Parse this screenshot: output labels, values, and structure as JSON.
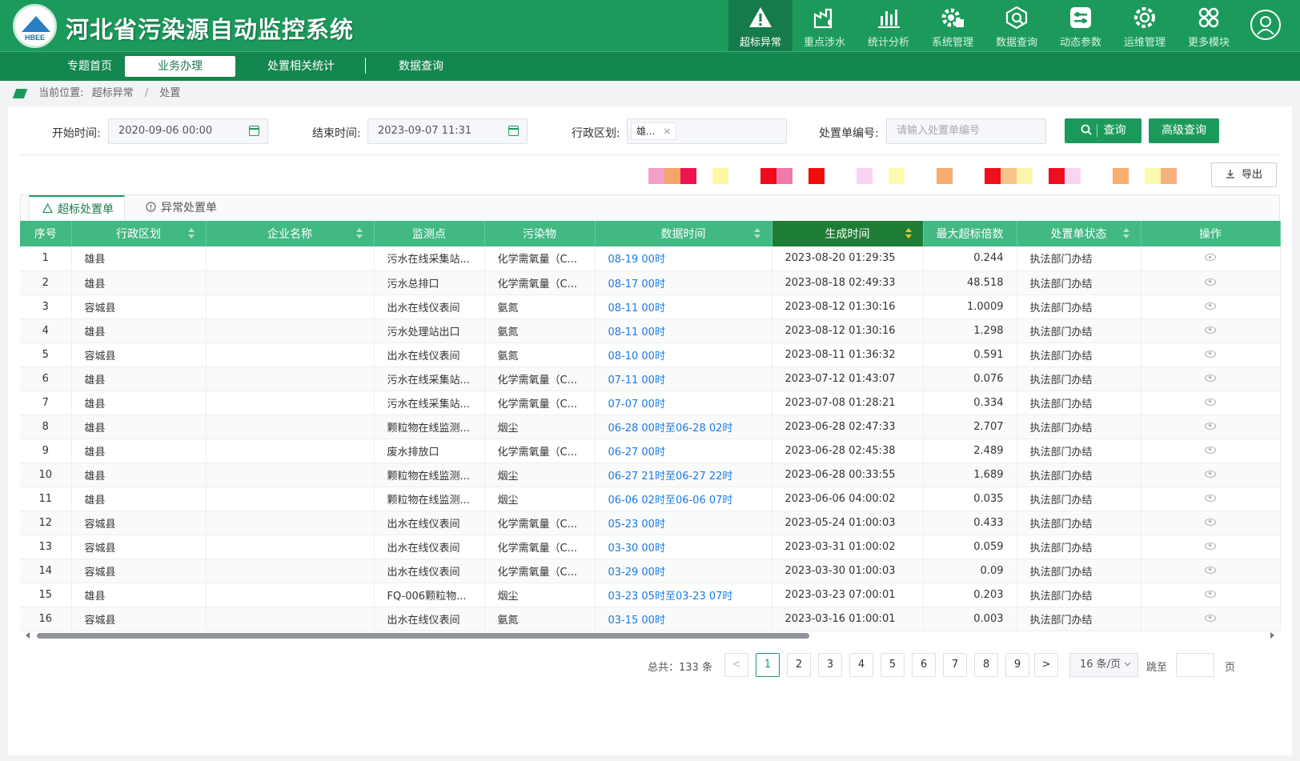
{
  "app": {
    "title": "河北省污染源自动监控系统",
    "logo_text": "HBEE"
  },
  "modules": [
    {
      "label": "超标异常",
      "icon": "warning-icon",
      "active": true
    },
    {
      "label": "重点涉水",
      "icon": "factory-icon"
    },
    {
      "label": "统计分析",
      "icon": "bar-chart-icon"
    },
    {
      "label": "系统管理",
      "icon": "gear-icon"
    },
    {
      "label": "数据查询",
      "icon": "data-search-icon"
    },
    {
      "label": "动态参数",
      "icon": "sliders-icon"
    },
    {
      "label": "运维管理",
      "icon": "settings-cog-icon"
    },
    {
      "label": "更多模块",
      "icon": "grid-icon"
    }
  ],
  "subnav": [
    {
      "label": "专题首页"
    },
    {
      "label": "业务办理",
      "active": true
    },
    {
      "label": "处置相关统计"
    },
    {
      "label": "数据查询"
    }
  ],
  "breadcrumb": {
    "prefix": "当前位置:",
    "level1": "超标异常",
    "divider": "/",
    "level2": "处置"
  },
  "filters": {
    "start_label": "开始时间:",
    "start_value": "2020-09-06 00:00",
    "end_label": "结束时间:",
    "end_value": "2023-09-07 11:31",
    "region_label": "行政区划:",
    "region_chip": "雄...",
    "order_label": "处置单编号:",
    "order_placeholder": "请输入处置单编号",
    "query_button": "查询",
    "advanced_button": "高级查询",
    "export_button": "导出"
  },
  "tabs": [
    {
      "label": "超标处置单",
      "active": true
    },
    {
      "label": "异常处置单"
    }
  ],
  "table": {
    "columns": [
      "序号",
      "行政区划",
      "企业名称",
      "监测点",
      "污染物",
      "数据时间",
      "生成时间",
      "最大超标倍数",
      "处置单状态",
      "操作"
    ],
    "rows": [
      [
        "1",
        "雄县",
        "",
        "污水在线采集站...",
        "化学需氧量（C...",
        "08-19 00时",
        "2023-08-20 01:29:35",
        "0.244",
        "执法部门办结"
      ],
      [
        "2",
        "雄县",
        "",
        "污水总排口",
        "化学需氧量（C...",
        "08-17 00时",
        "2023-08-18 02:49:33",
        "48.518",
        "执法部门办结"
      ],
      [
        "3",
        "容城县",
        "",
        "出水在线仪表间",
        "氨氮",
        "08-11 00时",
        "2023-08-12 01:30:16",
        "1.0009",
        "执法部门办结"
      ],
      [
        "4",
        "雄县",
        "",
        "污水处理站出口",
        "氨氮",
        "08-11 00时",
        "2023-08-12 01:30:16",
        "1.298",
        "执法部门办结"
      ],
      [
        "5",
        "容城县",
        "",
        "出水在线仪表间",
        "氨氮",
        "08-10 00时",
        "2023-08-11 01:36:32",
        "0.591",
        "执法部门办结"
      ],
      [
        "6",
        "雄县",
        "",
        "污水在线采集站...",
        "化学需氧量（C...",
        "07-11 00时",
        "2023-07-12 01:43:07",
        "0.076",
        "执法部门办结"
      ],
      [
        "7",
        "雄县",
        "",
        "污水在线采集站...",
        "化学需氧量（C...",
        "07-07 00时",
        "2023-07-08 01:28:21",
        "0.334",
        "执法部门办结"
      ],
      [
        "8",
        "雄县",
        "",
        "颗粒物在线监测...",
        "烟尘",
        "06-28 00时至06-28 02时",
        "2023-06-28 02:47:33",
        "2.707",
        "执法部门办结"
      ],
      [
        "9",
        "雄县",
        "",
        "废水排放口",
        "化学需氧量（C...",
        "06-27 00时",
        "2023-06-28 02:45:38",
        "2.489",
        "执法部门办结"
      ],
      [
        "10",
        "雄县",
        "",
        "颗粒物在线监测...",
        "烟尘",
        "06-27 21时至06-27 22时",
        "2023-06-28 00:33:55",
        "1.689",
        "执法部门办结"
      ],
      [
        "11",
        "雄县",
        "",
        "颗粒物在线监测...",
        "烟尘",
        "06-06 02时至06-06 07时",
        "2023-06-06 04:00:02",
        "0.035",
        "执法部门办结"
      ],
      [
        "12",
        "容城县",
        "",
        "出水在线仪表间",
        "化学需氧量（C...",
        "05-23 00时",
        "2023-05-24 01:00:03",
        "0.433",
        "执法部门办结"
      ],
      [
        "13",
        "容城县",
        "",
        "出水在线仪表间",
        "化学需氧量（C...",
        "03-30 00时",
        "2023-03-31 01:00:02",
        "0.059",
        "执法部门办结"
      ],
      [
        "14",
        "容城县",
        "",
        "出水在线仪表间",
        "化学需氧量（C...",
        "03-29 00时",
        "2023-03-30 01:00:03",
        "0.09",
        "执法部门办结"
      ],
      [
        "15",
        "雄县",
        "",
        "FQ-006颗粒物...",
        "烟尘",
        "03-23 05时至03-23 07时",
        "2023-03-23 07:00:01",
        "0.203",
        "执法部门办结"
      ],
      [
        "16",
        "容城县",
        "",
        "出水在线仪表间",
        "氨氮",
        "03-15 00时",
        "2023-03-16 01:00:01",
        "0.003",
        "执法部门办结"
      ]
    ]
  },
  "pagination": {
    "total": "总共：133 条",
    "pages": [
      "1",
      "2",
      "3",
      "4",
      "5",
      "6",
      "7",
      "8",
      "9"
    ],
    "current": "1",
    "prev": "<",
    "next": ">",
    "page_size": "16 条/页",
    "jump_label": "跳至",
    "page_suffix": "页"
  },
  "colors": {
    "primary": "#1c9a5c",
    "header_green": "#42b883",
    "sorted_header": "#1e7d35",
    "link_blue": "#1a7be0"
  }
}
